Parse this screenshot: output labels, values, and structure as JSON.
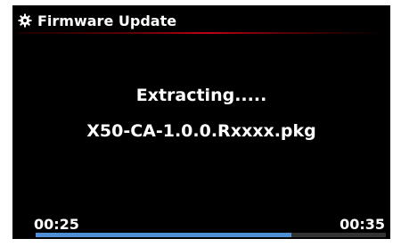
{
  "header": {
    "icon": "gear-icon",
    "title": "Firmware Update"
  },
  "main": {
    "status": "Extracting.....",
    "filename": "X50-CA-1.0.0.Rxxxx.pkg"
  },
  "progress": {
    "elapsed": "00:25",
    "total": "00:35",
    "fraction": 0.73,
    "fill_color": "#4f8fd6"
  },
  "colors": {
    "background": "#000000",
    "accent_line": "#c0001a",
    "text": "#ffffff"
  }
}
